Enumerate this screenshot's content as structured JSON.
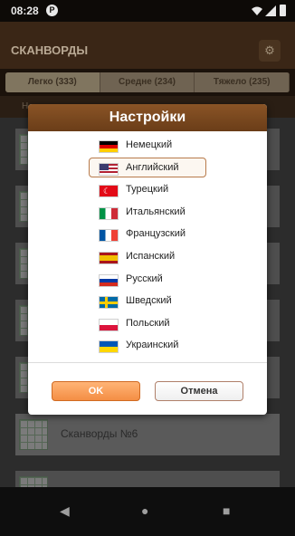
{
  "status": {
    "time": "08:28",
    "app_icon": "P"
  },
  "app": {
    "title": "СКАНВОРДЫ",
    "tabs": [
      "Легко (333)",
      "Средне (234)",
      "Тяжело (235)"
    ],
    "subtab": "Н",
    "rows": [
      "Сканворды №6"
    ]
  },
  "dialog": {
    "title": "Настройки",
    "languages": [
      {
        "name": "Немецкий",
        "flag": "de-flag-icon"
      },
      {
        "name": "Английский",
        "flag": "us-flag-icon"
      },
      {
        "name": "Турецкий",
        "flag": "tr-flag-icon"
      },
      {
        "name": "Итальянский",
        "flag": "it-flag-icon"
      },
      {
        "name": "Французский",
        "flag": "fr-flag-icon"
      },
      {
        "name": "Испанский",
        "flag": "es-flag-icon"
      },
      {
        "name": "Русский",
        "flag": "ru-flag-icon"
      },
      {
        "name": "Шведский",
        "flag": "se-flag-icon"
      },
      {
        "name": "Польский",
        "flag": "pl-flag-icon"
      },
      {
        "name": "Украинский",
        "flag": "ua-flag-icon"
      }
    ],
    "selected": "Английский",
    "ok_label": "OK",
    "cancel_label": "Отмена"
  },
  "colors": {
    "header": "#7a4720",
    "ok_button": "#f59a52",
    "selected_border": "#b87a4b"
  }
}
